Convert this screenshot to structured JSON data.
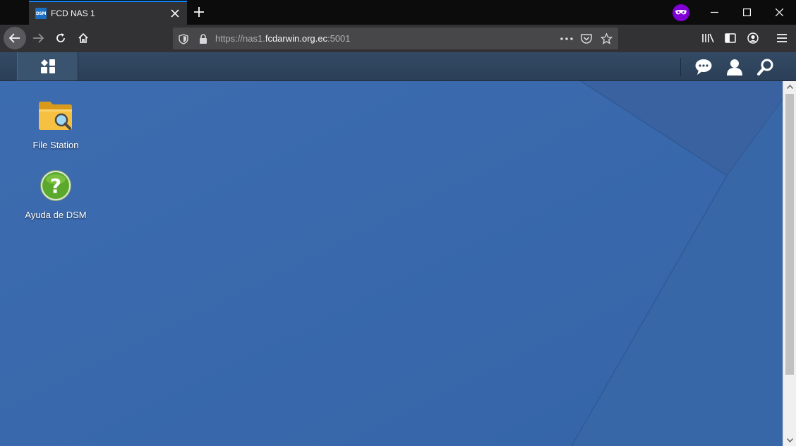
{
  "browser": {
    "tab": {
      "favicon_text": "DSM",
      "title": "FCD NAS 1"
    },
    "url": {
      "prefix": "https://nas1.",
      "host": "fcdarwin.org.ec",
      "suffix": ":5001"
    },
    "colors": {
      "accent": "#0a84ff",
      "private_badge": "#8000d7"
    }
  },
  "dsm": {
    "desktop_icons": [
      {
        "label": "File Station",
        "icon": "folder-search-icon"
      },
      {
        "label": "Ayuda de DSM",
        "icon": "help-question-icon"
      }
    ],
    "taskbar_icons": [
      "main-menu-icon",
      "notifications-chat-icon",
      "user-icon",
      "search-icon"
    ],
    "colors": {
      "desktop": "#3a6aad",
      "taskbar": "#2f445d"
    }
  }
}
